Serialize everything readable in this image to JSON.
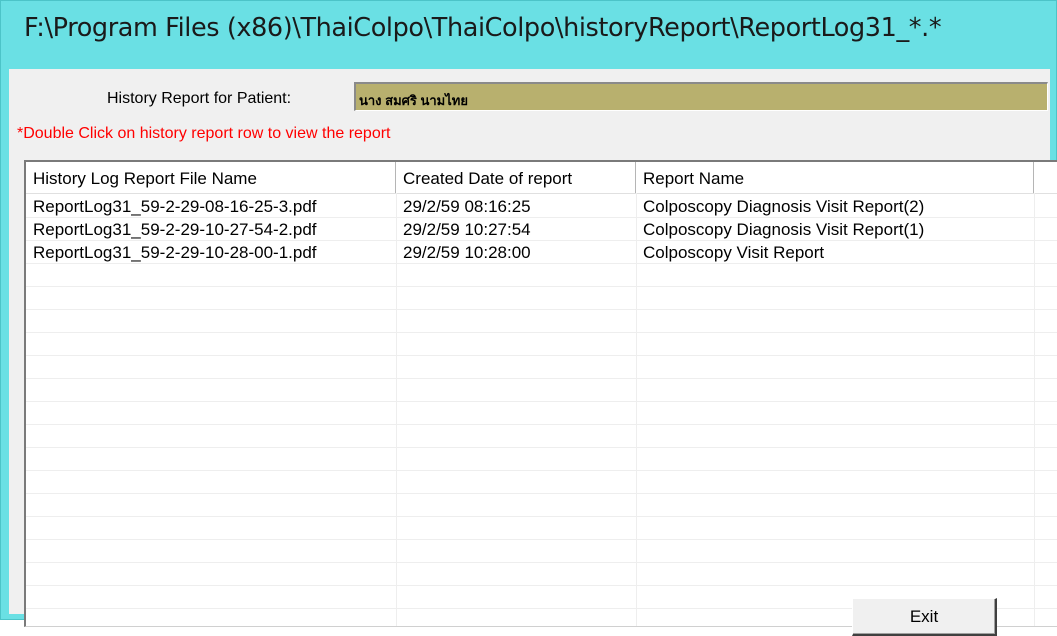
{
  "window": {
    "title": "F:\\Program Files (x86)\\ThaiColpo\\ThaiColpo\\historyReport\\ReportLog31_*.*"
  },
  "patient": {
    "label": "History Report for Patient:",
    "name": "นาง สมศริ นามไทย"
  },
  "hint": "*Double Click on history report row to view the report",
  "table": {
    "columns": [
      "History Log Report File Name",
      "Created Date of report",
      "Report Name"
    ],
    "rows": [
      [
        "ReportLog31_59-2-29-08-16-25-3.pdf",
        "29/2/59 08:16:25",
        "Colposcopy Diagnosis Visit Report(2)"
      ],
      [
        "ReportLog31_59-2-29-10-27-54-2.pdf",
        "29/2/59 10:27:54",
        "Colposcopy Diagnosis Visit Report(1)"
      ],
      [
        "ReportLog31_59-2-29-10-28-00-1.pdf",
        "29/2/59 10:28:00",
        "Colposcopy Visit Report"
      ]
    ]
  },
  "buttons": {
    "exit": "Exit"
  },
  "colors": {
    "title_bar": "#6ae0e4",
    "patient_field": "#b8b06e",
    "hint_text": "#ff0000"
  }
}
